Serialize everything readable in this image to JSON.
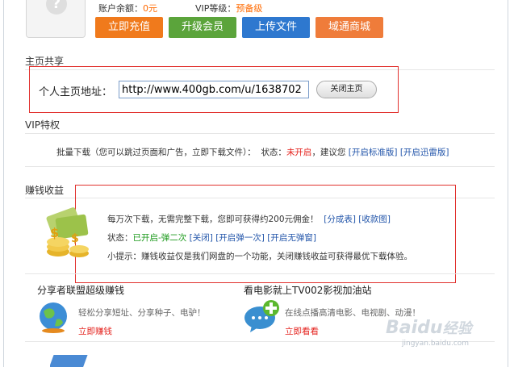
{
  "account": {
    "balance_label": "账户余额：",
    "balance_value": "0元",
    "vip_label": "VIP等级：",
    "vip_value": "预备级"
  },
  "buttons": [
    {
      "label": "立即充值",
      "color": "#f07a1c"
    },
    {
      "label": "升级会员",
      "color": "#5ba43b"
    },
    {
      "label": "上传文件",
      "color": "#2e78cf"
    },
    {
      "label": "域通商城",
      "color": "#ef7c3a"
    }
  ],
  "homepage": {
    "section_title": "主页共享",
    "url_label": "个人主页地址：",
    "url_value": "http://www.400gb.com/u/1638702",
    "close_button": "关闭主页"
  },
  "vip": {
    "section_title": "VIP特权",
    "desc": "批量下载（您可以跳过页面和广告，立即下载文件）：",
    "status_label": "状态：",
    "status_value": "未开启",
    "suggest": "，建议您",
    "link1": "[开启标准版]",
    "link2": "[开启迅雷版]"
  },
  "earn": {
    "section_title": "赚钱收益",
    "line1": "每万次下载，无需完整下载，您即可获得约200元佣金！",
    "line1_link1": "[分成表]",
    "line1_link2": "[收款图]",
    "status_label": "状态：",
    "status_value": "已开启-弹二次",
    "link_close": "[关闭]",
    "link_once": "[开启弹一次]",
    "link_none": "[开启无弹窗]",
    "tip": "小提示：赚钱收益仅是我们网盘的一个功能，关闭赚钱收益可获得最优下载体验。"
  },
  "promo": [
    {
      "title": "分享者联盟超级赚钱",
      "desc": "轻松分享短址、分享种子、电驴！",
      "link": "立即赚钱"
    },
    {
      "title": "看电影就上TV002影视加油站",
      "desc": "在线点播高清电影、电视剧、动漫！",
      "link": "立即看看"
    }
  ],
  "watermark": {
    "brand": "Baidu",
    "suffix": "经验",
    "url": "jingyan.baidu.com"
  },
  "colors": {
    "red_box": "#e1312e",
    "link": "#2255aa",
    "orange": "#ff6a00",
    "green": "#1c9a1c"
  }
}
